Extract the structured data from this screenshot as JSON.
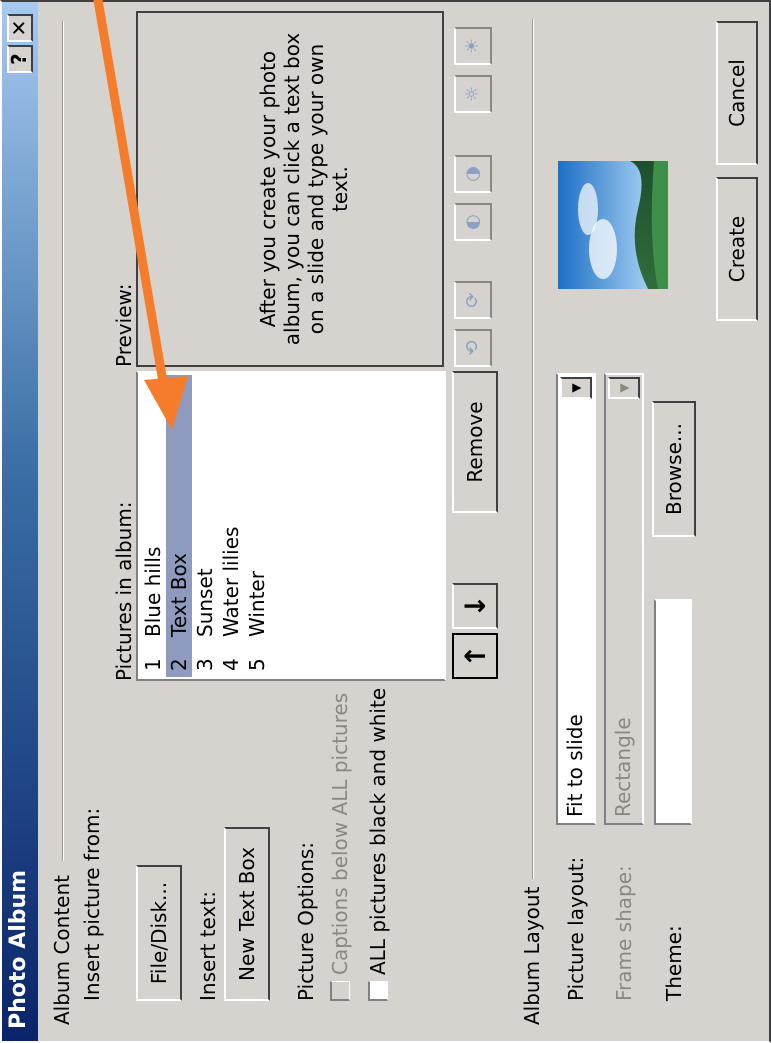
{
  "window": {
    "title": "Photo Album",
    "help_label": "?",
    "close_label": "✕"
  },
  "album_content": {
    "group_label": "Album Content",
    "insert_picture_label": "Insert picture from:",
    "file_disk_button": "File/Disk...",
    "insert_text_label": "Insert text:",
    "new_text_box_button": "New Text Box",
    "picture_options_label": "Picture Options:",
    "captions_label": "Captions below ALL pictures",
    "black_white_label": "ALL pictures black and white",
    "pictures_label": "Pictures in album:",
    "pictures": [
      {
        "num": "1",
        "name": "Blue hills",
        "selected": false
      },
      {
        "num": "2",
        "name": "Text Box",
        "selected": true
      },
      {
        "num": "3",
        "name": "Sunset",
        "selected": false
      },
      {
        "num": "4",
        "name": "Water lilies",
        "selected": false
      },
      {
        "num": "5",
        "name": "Winter",
        "selected": false
      }
    ],
    "move_up_label": "↑",
    "move_down_label": "↓",
    "remove_button": "Remove",
    "preview_label": "Preview:",
    "preview_text": "After you create your photo album, you can click a text box on a slide and type your own text."
  },
  "album_layout": {
    "group_label": "Album Layout",
    "picture_layout_label": "Picture layout:",
    "picture_layout_value": "Fit to slide",
    "frame_shape_label": "Frame shape:",
    "frame_shape_value": "Rectangle",
    "theme_label": "Theme:",
    "theme_value": "",
    "browse_button": "Browse..."
  },
  "buttons": {
    "create": "Create",
    "cancel": "Cancel"
  },
  "colors": {
    "selection": "#8e9bbf",
    "title_bar": "#0a246a",
    "annotation_arrow": "#f47c2a",
    "dialog_face": "#d6d3ce"
  },
  "icons": [
    "rotate-left-icon",
    "rotate-right-icon",
    "contrast-more-icon",
    "contrast-less-icon",
    "brightness-more-icon",
    "brightness-less-icon"
  ]
}
